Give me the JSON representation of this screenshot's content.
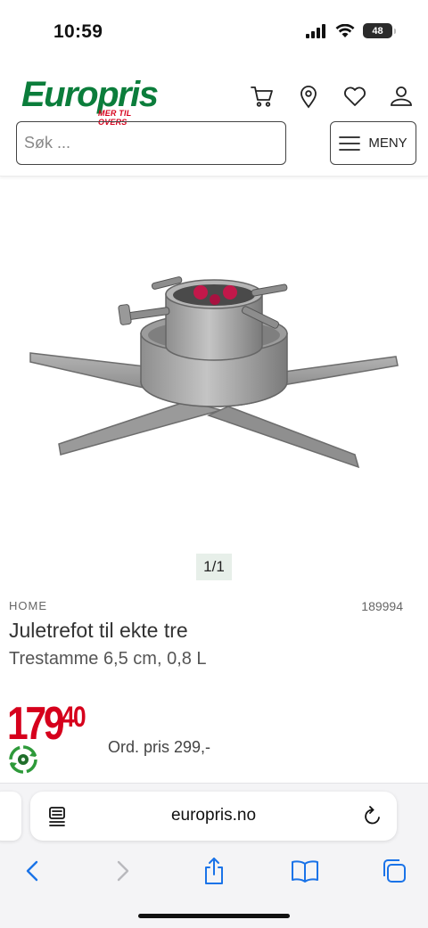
{
  "status_bar": {
    "time": "10:59",
    "battery": "48"
  },
  "header": {
    "logo_text": "Europris",
    "logo_tagline": "MER TIL OVERS",
    "search_placeholder": "Søk ...",
    "menu_label": "MENY",
    "icons": [
      "cart-icon",
      "location-pin-icon",
      "heart-icon",
      "user-icon",
      "hamburger-icon"
    ]
  },
  "gallery": {
    "pager": "1/1"
  },
  "product": {
    "brand": "HOME",
    "sku": "189994",
    "name": "Juletrefot til ekte tre",
    "subtitle": "Trestamme 6,5 cm, 0,8 L",
    "price_main": "179",
    "price_decimals": "40",
    "ordinary_price": "Ord. pris 299,-"
  },
  "browser": {
    "url": "europris.no",
    "icons": [
      "reader-icon",
      "reload-icon",
      "back-icon",
      "forward-icon",
      "share-icon",
      "bookmarks-icon",
      "tabs-icon"
    ]
  },
  "colors": {
    "brand_green": "#0b7d3b",
    "price_red": "#d6001c",
    "safari_blue": "#1a73e8"
  }
}
